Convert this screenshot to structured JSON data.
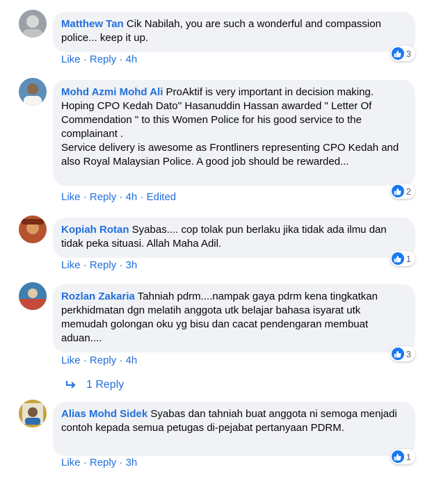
{
  "comments": [
    {
      "author": "Matthew Tan",
      "text": "Cik Nabilah, you are such a wonderful and compassion police... keep it up.",
      "like": "Like",
      "reply": "Reply",
      "time": "4h",
      "edited": "",
      "reactions": "3"
    },
    {
      "author": "Mohd Azmi Mohd Ali",
      "text": "ProAktif is very important in decision making. Hoping CPO Kedah Dato'' Hasanuddin Hassan awarded \" Letter Of Commendation \" to this Women Police for his good service to the complainant .\nService delivery is awesome as Frontliners representing CPO Kedah and also Royal Malaysian Police. A good job should be rewarded...",
      "like": "Like",
      "reply": "Reply",
      "time": "4h",
      "edited": "Edited",
      "reactions": "2"
    },
    {
      "author": "Kopiah Rotan",
      "text": "Syabas.... cop tolak pun berlaku jika tidak ada ilmu dan tidak peka situasi. Allah Maha Adil.",
      "like": "Like",
      "reply": "Reply",
      "time": "3h",
      "edited": "",
      "reactions": "1"
    },
    {
      "author": "Rozlan Zakaria",
      "text": "Tahniah pdrm....nampak gaya pdrm kena tingkatkan perkhidmatan dgn melatih anggota utk belajar bahasa isyarat utk memudah golongan oku yg bisu dan cacat pendengaran membuat aduan....",
      "like": "Like",
      "reply": "Reply",
      "time": "4h",
      "edited": "",
      "reactions": "3"
    },
    {
      "author": "Alias Mohd Sidek",
      "text": "Syabas dan tahniah buat anggota ni semoga menjadi contoh kepada semua petugas di-pejabat pertanyaan PDRM.",
      "like": "Like",
      "reply": "Reply",
      "time": "3h",
      "edited": "",
      "reactions": "1"
    }
  ],
  "replies_link": "1 Reply",
  "colors": {
    "link": "#216fdb",
    "bubble": "#f0f2f5",
    "like_badge": "#1877f2"
  },
  "icons": {
    "like": "like-icon",
    "reply_arrow": "reply-arrow-icon"
  }
}
